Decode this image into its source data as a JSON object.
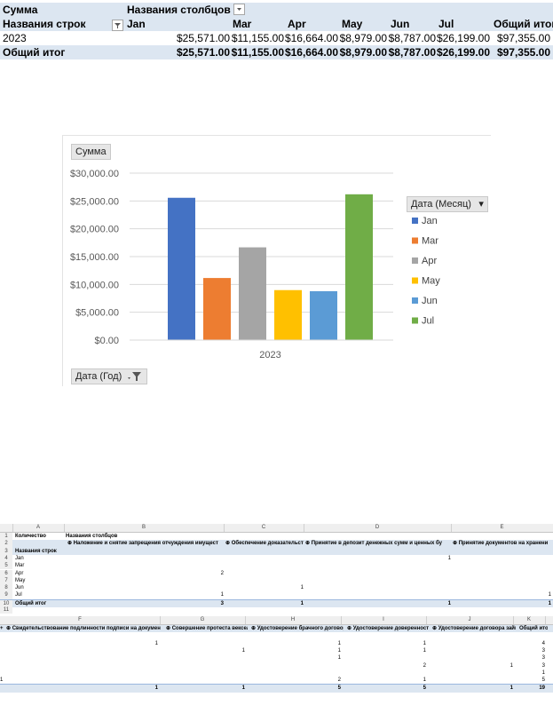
{
  "pivot_top": {
    "header_sum": "Сумма",
    "header_columns": "Названия столбцов",
    "header_rows": "Названия строк",
    "months": [
      "Jan",
      "Mar",
      "Apr",
      "May",
      "Jun",
      "Jul"
    ],
    "grand_total_label": "Общий итог",
    "rows": [
      {
        "label": "2023",
        "values": [
          "$25,571.00",
          "$11,155.00",
          "$16,664.00",
          "$8,979.00",
          "$8,787.00",
          "$26,199.00"
        ],
        "total": "$97,355.00"
      }
    ],
    "grand_row": {
      "label": "Общий итог",
      "values": [
        "$25,571.00",
        "$11,155.00",
        "$16,664.00",
        "$8,979.00",
        "$8,787.00",
        "$26,199.00"
      ],
      "total": "$97,355.00"
    }
  },
  "chart": {
    "sum_button": "Сумма",
    "legend_button": "Дата (Месяц)",
    "filter_button": "Дата (Год)",
    "colors": {
      "Jan": "#4472c4",
      "Mar": "#ed7d31",
      "Apr": "#a5a5a5",
      "May": "#ffc000",
      "Jun": "#5b9bd5",
      "Jul": "#70ad47"
    }
  },
  "chart_data": {
    "type": "bar",
    "categories": [
      "2023"
    ],
    "series": [
      {
        "name": "Jan",
        "values": [
          25571
        ]
      },
      {
        "name": "Mar",
        "values": [
          11155
        ]
      },
      {
        "name": "Apr",
        "values": [
          16664
        ]
      },
      {
        "name": "May",
        "values": [
          8979
        ]
      },
      {
        "name": "Jun",
        "values": [
          8787
        ]
      },
      {
        "name": "Jul",
        "values": [
          26199
        ]
      }
    ],
    "yticks": [
      "$0.00",
      "$5,000.00",
      "$10,000.00",
      "$15,000.00",
      "$20,000.00",
      "$25,000.00",
      "$30,000.00"
    ],
    "ylim": [
      0,
      30000
    ],
    "grid": true,
    "legend": "right"
  },
  "sheet_grid1": {
    "columns": [
      "A",
      "B",
      "C",
      "D",
      "E"
    ],
    "row_numbers": [
      "1",
      "2",
      "3",
      "4",
      "5",
      "6",
      "7",
      "8",
      "9",
      "10",
      "11"
    ],
    "a1": "Количество",
    "b1": "Названия столбцов",
    "col_headers": [
      "Наложение и снятие запрещения отчуждения имущест",
      "Обеспечение доказательст",
      "Принятие в депозит денежных сумм и ценных бу",
      "Принятие документов на хранени"
    ],
    "row_label_header": "Названия строк",
    "months": [
      "Jan",
      "Mar",
      "Apr",
      "May",
      "Jun",
      "Jul"
    ],
    "total_label": "Общий итог",
    "cells": {
      "jan_e": "1",
      "apr_b": "2",
      "jun_c": "1",
      "jul_b": "1",
      "jul_end": "1",
      "tot_b": "3",
      "tot_c": "1",
      "tot_d": "1",
      "tot_e": "1"
    }
  },
  "sheet_grid2": {
    "columns": [
      "F",
      "G",
      "H",
      "I",
      "J",
      "K"
    ],
    "col_headers": [
      "Свидетельствование подлинности подписи на документа",
      "Совершение протеста векселе",
      "Удостоверение брачного договор",
      "Удостоверение доверенност",
      "Удостоверение договора займ",
      "Общий итог"
    ],
    "left_marker": "+",
    "rows": [
      [
        "",
        "1",
        "",
        "1",
        "1",
        "",
        "4"
      ],
      [
        "",
        "",
        "1",
        "1",
        "1",
        "",
        "3"
      ],
      [
        "",
        "",
        "",
        "1",
        "",
        "",
        "3"
      ],
      [
        "",
        "",
        "",
        "",
        "2",
        "1",
        "3"
      ],
      [
        "",
        "",
        "",
        "",
        "",
        "",
        "1"
      ],
      [
        "1",
        "",
        "",
        "2",
        "1",
        "",
        "5"
      ]
    ],
    "total_row": [
      "",
      "1",
      "1",
      "5",
      "5",
      "1",
      "19"
    ]
  }
}
